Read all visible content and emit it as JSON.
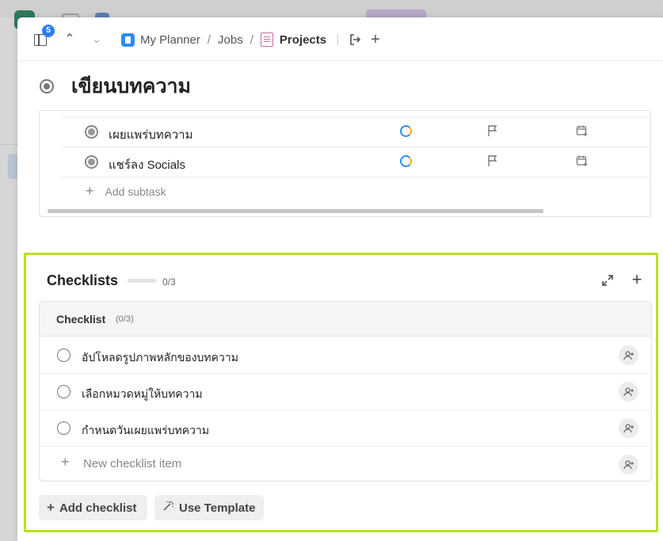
{
  "topbar": {
    "notification_count": "5",
    "breadcrumb": [
      "My Planner",
      "Jobs",
      "Projects"
    ]
  },
  "task": {
    "title": "เขียนบทความ"
  },
  "subtasks": {
    "items": [
      {
        "label": "เผยแพร่บทความ"
      },
      {
        "label": "แชร์ลง Socials"
      }
    ],
    "add_label": "Add subtask"
  },
  "checklists": {
    "title": "Checklists",
    "count": "0/3",
    "progress": 0,
    "list": {
      "name": "Checklist",
      "count": "(0/3)",
      "items": [
        {
          "text": "อัปโหลดรูปภาพหลักของบทความ"
        },
        {
          "text": "เลือกหมวดหมู่ให้บทความ"
        },
        {
          "text": "กำหนดวันเผยแพร่บทความ"
        }
      ],
      "new_item_placeholder": "New checklist item"
    },
    "add_checklist_label": "Add checklist",
    "use_template_label": "Use Template"
  },
  "colors": {
    "accent": "#2d8cf0",
    "highlight_border": "#b8e21c",
    "badge": "#2d7ff9"
  }
}
